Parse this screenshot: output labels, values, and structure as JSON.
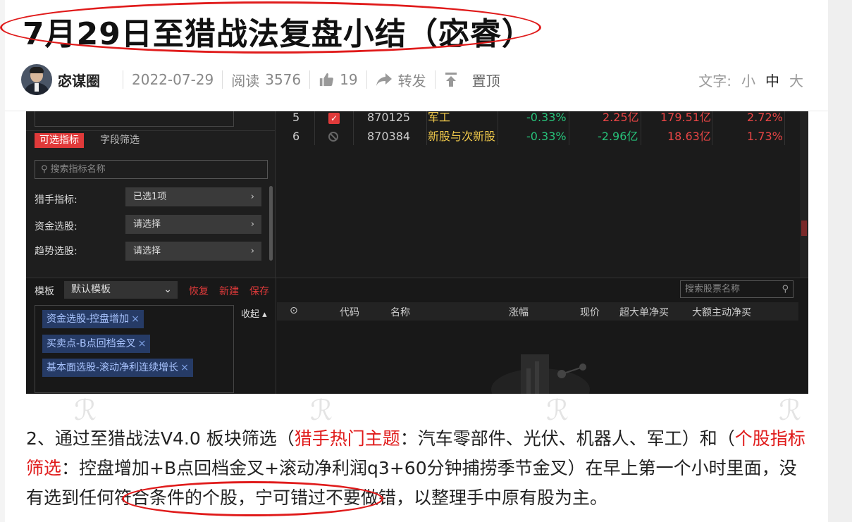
{
  "article": {
    "title": "7月29日至猎战法复盘小结（宓睿）",
    "author": "宓谋圈",
    "date": "2022-07-29",
    "read_label": "阅读",
    "read_count": "3576",
    "like_count": "19",
    "share_label": "转发",
    "pin_label": "置顶",
    "font_label": "文字:",
    "font_small": "小",
    "font_medium": "中",
    "font_large": "大"
  },
  "screenshot": {
    "tab_active": "可选指标",
    "tab_field": "字段筛选",
    "search_placeholder": "搜索指标名称",
    "rows": [
      {
        "label": "猎手指标:",
        "value": "已选1项"
      },
      {
        "label": "资金选股:",
        "value": "请选择"
      },
      {
        "label": "趋势选股:",
        "value": "请选择"
      }
    ],
    "stocks": [
      {
        "idx": "5",
        "code": "870125",
        "name": "军工",
        "chg": "-0.33%",
        "net": "2.25亿",
        "cap": "179.51亿",
        "pct": "2.72%"
      },
      {
        "idx": "6",
        "code": "870384",
        "name": "新股与次新股",
        "chg": "-0.33%",
        "net": "-2.96亿",
        "cap": "18.63亿",
        "pct": "1.73%"
      }
    ],
    "template_label": "模板",
    "template_value": "默认模板",
    "restore": "恢复",
    "new": "新建",
    "save": "保存",
    "fold": "收起",
    "tags": [
      "资金选股-控盘增加",
      "买卖点-B点回档金叉",
      "基本面选股-滚动净利连续增长"
    ],
    "stock_search_placeholder": "搜索股票名称",
    "columns": [
      "代码",
      "名称",
      "涨幅",
      "现价",
      "超大单净买",
      "大额主动净买"
    ]
  },
  "paragraph": {
    "p1": "2、通过至猎战法V4.0 板块筛选（",
    "p2": "猎手热门主题",
    "p3": "：汽车零部件、光伏、机器人、军工）和（",
    "p4": "个股指标筛选",
    "p5": "：控盘增加+B点回档金叉+滚动净利润q3+60分钟捕捞季节金叉）在早上第一个小时里面，没有选到任何符合条件的个股，宁可错过不要做错，以整理手中原有股为主。"
  },
  "colors": {
    "accent_red": "#e01b1b",
    "tag_bg": "#263b66",
    "dark_bg": "#1b1b1b"
  }
}
